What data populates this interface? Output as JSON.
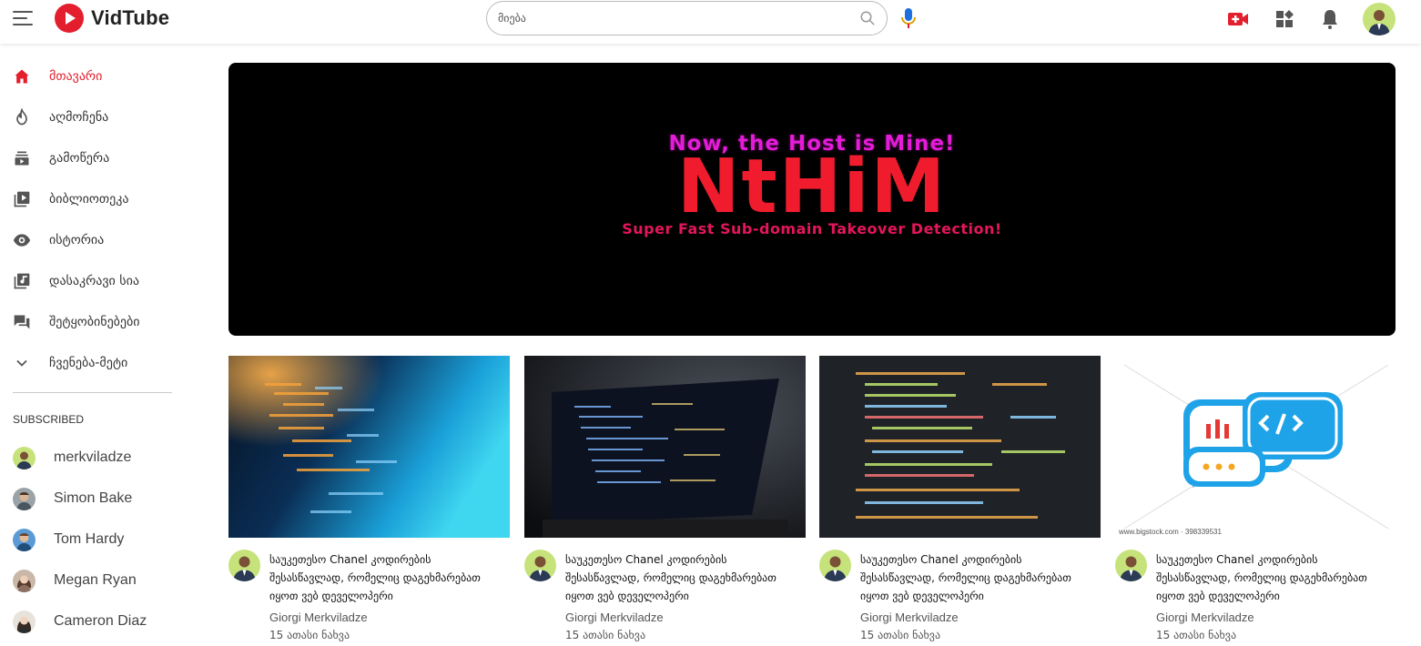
{
  "brand": {
    "name": "VidTube",
    "accent": "#e31e2d"
  },
  "search": {
    "placeholder": "მიება",
    "value": ""
  },
  "header_icons": [
    "menu-icon",
    "search-icon",
    "mic-icon",
    "video-add-icon",
    "apps-icon",
    "bell-icon",
    "avatar"
  ],
  "sidebar": {
    "items": [
      {
        "label": "მთავარი",
        "icon": "home-icon",
        "active": true
      },
      {
        "label": "აღმოჩენა",
        "icon": "fire-icon",
        "active": false
      },
      {
        "label": "გამოწერა",
        "icon": "subscriptions-icon",
        "active": false
      },
      {
        "label": "ბიბლიოთეკა",
        "icon": "library-icon",
        "active": false
      },
      {
        "label": "ისტორია",
        "icon": "history-icon",
        "active": false
      },
      {
        "label": "დასაკრავი სია",
        "icon": "playlist-icon",
        "active": false
      },
      {
        "label": "შეტყობინებები",
        "icon": "messages-icon",
        "active": false
      },
      {
        "label": "ჩვენება-მეტი",
        "icon": "chevron-down-icon",
        "active": false
      }
    ],
    "subscribed_heading": "SUBSCRIBED",
    "subscriptions": [
      {
        "name": "merkviladze"
      },
      {
        "name": "Simon Bake"
      },
      {
        "name": "Tom Hardy"
      },
      {
        "name": "Megan Ryan"
      },
      {
        "name": "Cameron Diaz"
      }
    ]
  },
  "banner": {
    "tagline": "Now, the Host is Mine!",
    "title": "NtHiM",
    "subtitle": "Super Fast Sub-domain Takeover Detection!"
  },
  "videos": [
    {
      "title": "საუკეთესო Chanel კოდირების შესასწავლად, რომელიც დაგეხმარებათ იყოთ ვებ დეველოპერი",
      "channel": "Giorgi Merkviladze",
      "views": "15 ათასი ნახვა"
    },
    {
      "title": "საუკეთესო Chanel კოდირების შესასწავლად, რომელიც დაგეხმარებათ იყოთ ვებ დეველოპერი",
      "channel": "Giorgi Merkviladze",
      "views": "15 ათასი ნახვა"
    },
    {
      "title": "საუკეთესო Chanel კოდირების შესასწავლად, რომელიც დაგეხმარებათ იყოთ ვებ დეველოპერი",
      "channel": "Giorgi Merkviladze",
      "views": "15 ათასი ნახვა"
    },
    {
      "title": "საუკეთესო Chanel კოდირების შესასწავლად, რომელიც დაგეხმარებათ იყოთ ვებ დეველოპერი",
      "channel": "Giorgi Merkviladze",
      "views": "15 ათასი ნახვა"
    }
  ],
  "thumbnail_watermark": "www.bigstock.com · 398339531"
}
